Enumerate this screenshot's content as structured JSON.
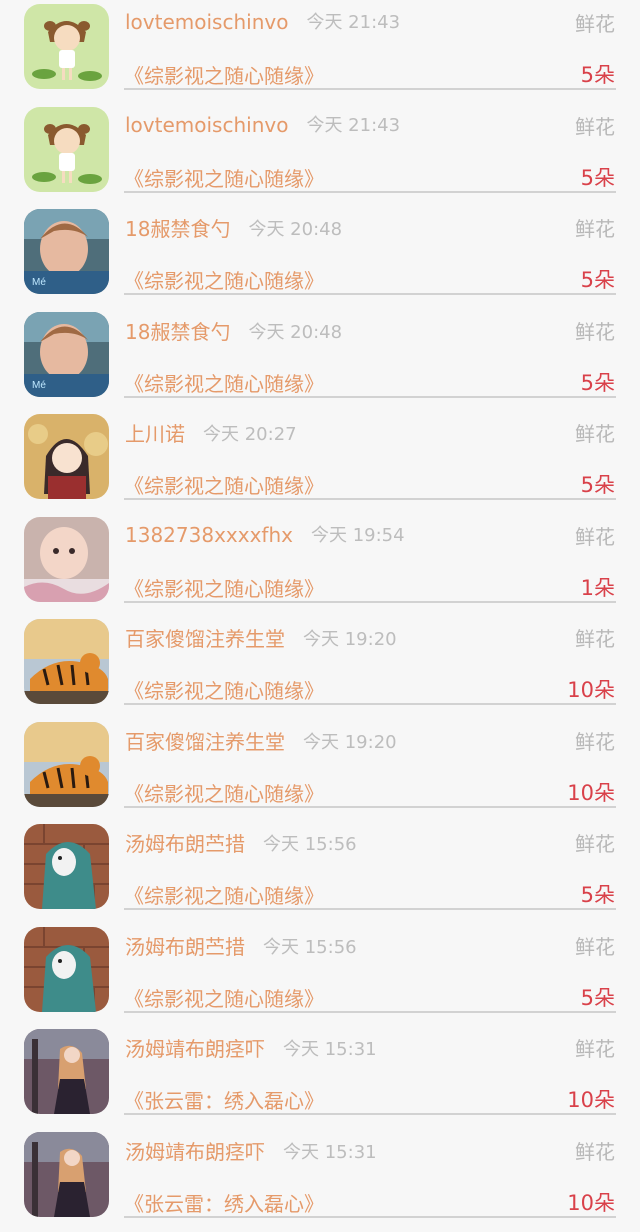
{
  "records": [
    {
      "user": "lovtemoischinvo",
      "time": "今天 21:43",
      "gift": "鲜花",
      "work": "《综影视之随心随缘》",
      "count": "5朵",
      "avatar": "cartoon-girl",
      "avatar_bg": "#cfe6a7"
    },
    {
      "user": "lovtemoischinvo",
      "time": "今天 21:43",
      "gift": "鲜花",
      "work": "《综影视之随心随缘》",
      "count": "5朵",
      "avatar": "cartoon-girl",
      "avatar_bg": "#cfe6a7"
    },
    {
      "user": "18赧禁食勺",
      "time": "今天 20:48",
      "gift": "鲜花",
      "work": "《综影视之随心随缘》",
      "count": "5朵",
      "avatar": "man-portrait",
      "avatar_bg": "#4f6e7a"
    },
    {
      "user": "18赧禁食勺",
      "time": "今天 20:48",
      "gift": "鲜花",
      "work": "《综影视之随心随缘》",
      "count": "5朵",
      "avatar": "man-portrait",
      "avatar_bg": "#4f6e7a"
    },
    {
      "user": "上川诺",
      "time": "今天 20:27",
      "gift": "鲜花",
      "work": "《综影视之随心随缘》",
      "count": "5朵",
      "avatar": "anime-girl",
      "avatar_bg": "#d9b26a"
    },
    {
      "user": "1382738xxxxfhx",
      "time": "今天 19:54",
      "gift": "鲜花",
      "work": "《综影视之随心随缘》",
      "count": "1朵",
      "avatar": "baby",
      "avatar_bg": "#c9b3ad"
    },
    {
      "user": "百家傻馏注养生堂",
      "time": "今天 19:20",
      "gift": "鲜花",
      "work": "《综影视之随心随缘》",
      "count": "10朵",
      "avatar": "tiger",
      "avatar_bg": "#b9c7d3"
    },
    {
      "user": "百家傻馏注养生堂",
      "time": "今天 19:20",
      "gift": "鲜花",
      "work": "《综影视之随心随缘》",
      "count": "10朵",
      "avatar": "tiger",
      "avatar_bg": "#b9c7d3"
    },
    {
      "user": "汤姆布朗苎措",
      "time": "今天 15:56",
      "gift": "鲜花",
      "work": "《综影视之随心随缘》",
      "count": "5朵",
      "avatar": "bear-hoodie",
      "avatar_bg": "#9a5a3e"
    },
    {
      "user": "汤姆布朗苎措",
      "time": "今天 15:56",
      "gift": "鲜花",
      "work": "《综影视之随心随缘》",
      "count": "5朵",
      "avatar": "bear-hoodie",
      "avatar_bg": "#9a5a3e"
    },
    {
      "user": "汤姆靖布朗痉吓",
      "time": "今天 15:31",
      "gift": "鲜花",
      "work": "《张云雷：绣入磊心》",
      "count": "10朵",
      "avatar": "woman-street",
      "avatar_bg": "#6d5866"
    },
    {
      "user": "汤姆靖布朗痉吓",
      "time": "今天 15:31",
      "gift": "鲜花",
      "work": "《张云雷：绣入磊心》",
      "count": "10朵",
      "avatar": "woman-street",
      "avatar_bg": "#6d5866"
    }
  ]
}
